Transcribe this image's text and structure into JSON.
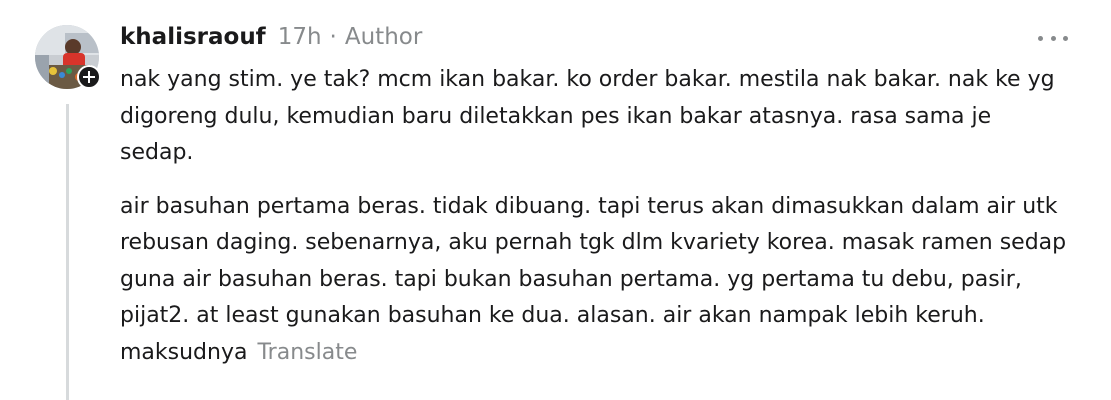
{
  "comment": {
    "author": "khalisraouf",
    "time": "17h",
    "separator": "·",
    "badge": "Author",
    "paragraphs": [
      "nak yang stim. ye tak? mcm ikan bakar. ko order bakar. mestila nak bakar. nak ke yg digoreng dulu, kemudian baru diletakkan pes ikan bakar atasnya. rasa sama je sedap.",
      "air basuhan pertama beras. tidak dibuang. tapi terus akan dimasukkan dalam air utk rebusan daging. sebenarnya, aku pernah tgk dlm kvariety korea. masak ramen sedap guna air basuhan beras. tapi bukan basuhan pertama. yg pertama tu debu, pasir, pijat2. at least gunakan basuhan ke dua. alasan. air akan nampak lebih keruh. maksudnya"
    ],
    "translate_label": "Translate"
  },
  "icons": {
    "expand": "plus-icon",
    "more": "more-options-icon"
  },
  "colors": {
    "text": "#1a1a1b",
    "muted": "#878a8c",
    "thread_line": "#d7dadc"
  }
}
